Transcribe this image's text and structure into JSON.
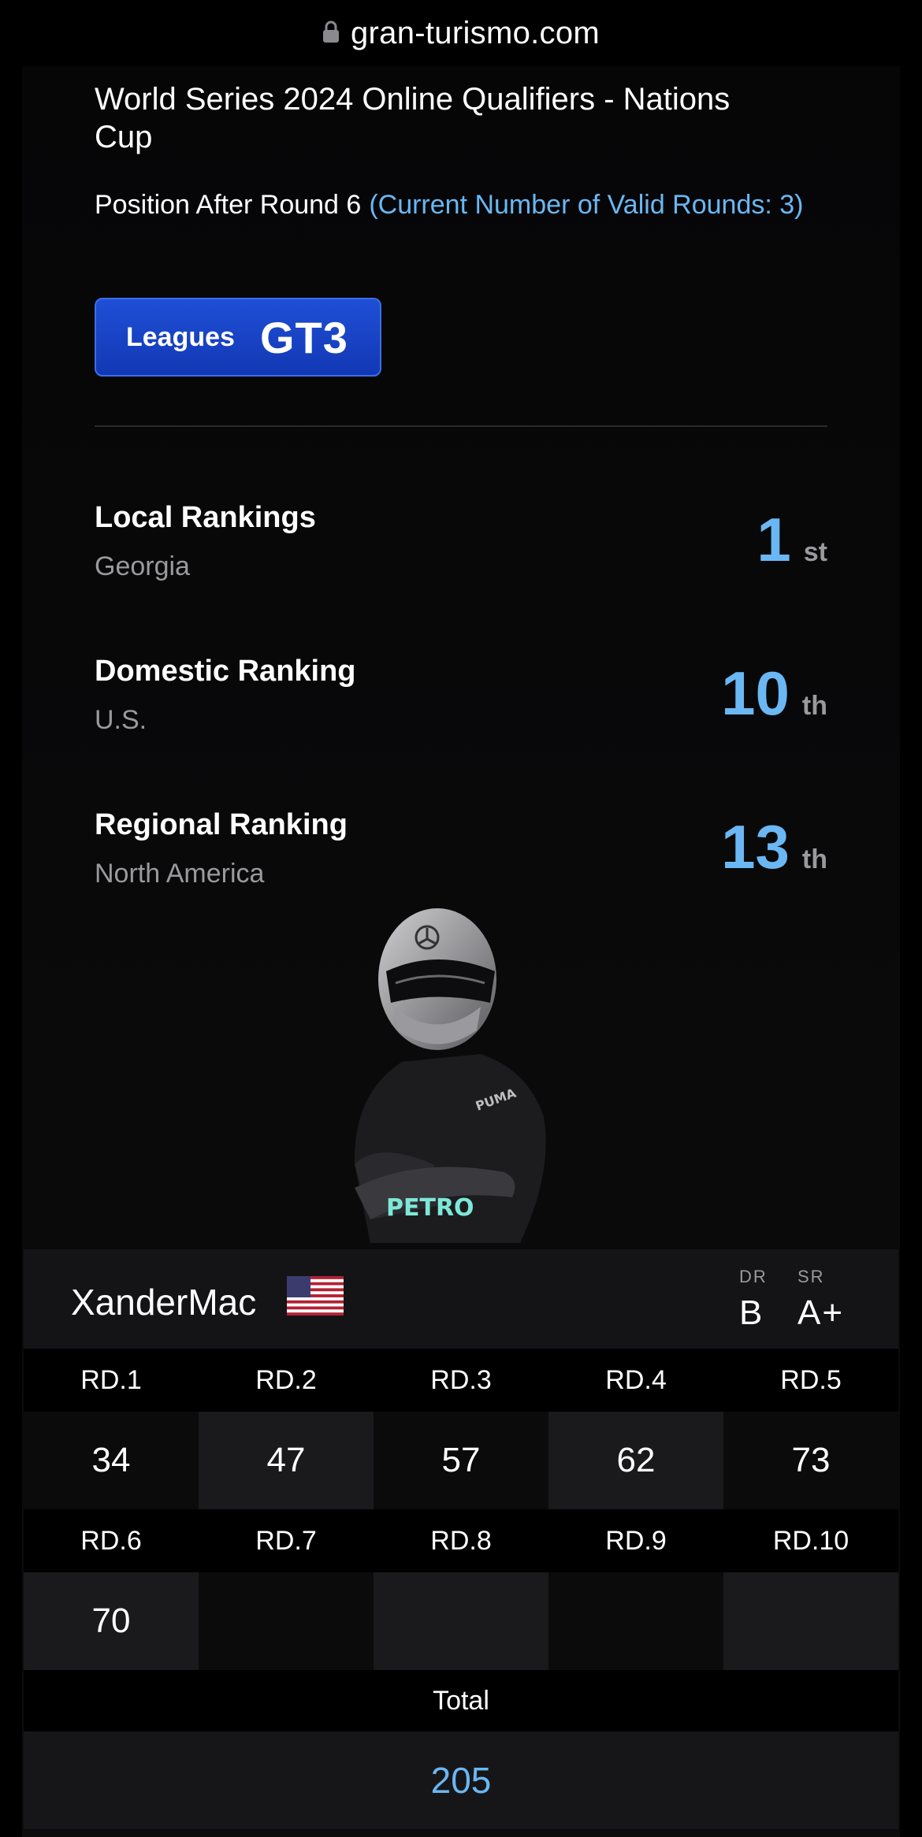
{
  "browser": {
    "url": "gran-turismo.com",
    "lock_icon": "lock-icon"
  },
  "event": {
    "title": "World Series 2024 Online Qualifiers - Nations Cup",
    "position_text": "Position After Round 6",
    "valid_rounds_text": "(Current Number of Valid Rounds: 3)"
  },
  "league": {
    "label": "Leagues",
    "value": "GT3",
    "color": "#1f4fd6"
  },
  "rankings": [
    {
      "title": "Local Rankings",
      "area": "Georgia",
      "rank": "1",
      "suffix": "st"
    },
    {
      "title": "Domestic Ranking",
      "area": "U.S.",
      "rank": "10",
      "suffix": "th"
    },
    {
      "title": "Regional Ranking",
      "area": "North America",
      "rank": "13",
      "suffix": "th"
    }
  ],
  "player": {
    "name": "XanderMac",
    "flag_icon": "us-flag-icon",
    "dr_label": "DR",
    "dr_value": "B",
    "sr_label": "SR",
    "sr_value": "A+"
  },
  "rounds": [
    {
      "label": "RD.1",
      "score": "34"
    },
    {
      "label": "RD.2",
      "score": "47"
    },
    {
      "label": "RD.3",
      "score": "57"
    },
    {
      "label": "RD.4",
      "score": "62"
    },
    {
      "label": "RD.5",
      "score": "73"
    },
    {
      "label": "RD.6",
      "score": "70"
    },
    {
      "label": "RD.7",
      "score": ""
    },
    {
      "label": "RD.8",
      "score": ""
    },
    {
      "label": "RD.9",
      "score": ""
    },
    {
      "label": "RD.10",
      "score": ""
    }
  ],
  "total": {
    "label": "Total",
    "value": "205"
  },
  "colors": {
    "accent": "#6ab7f3",
    "background": "#000000",
    "panel": "#141416"
  }
}
